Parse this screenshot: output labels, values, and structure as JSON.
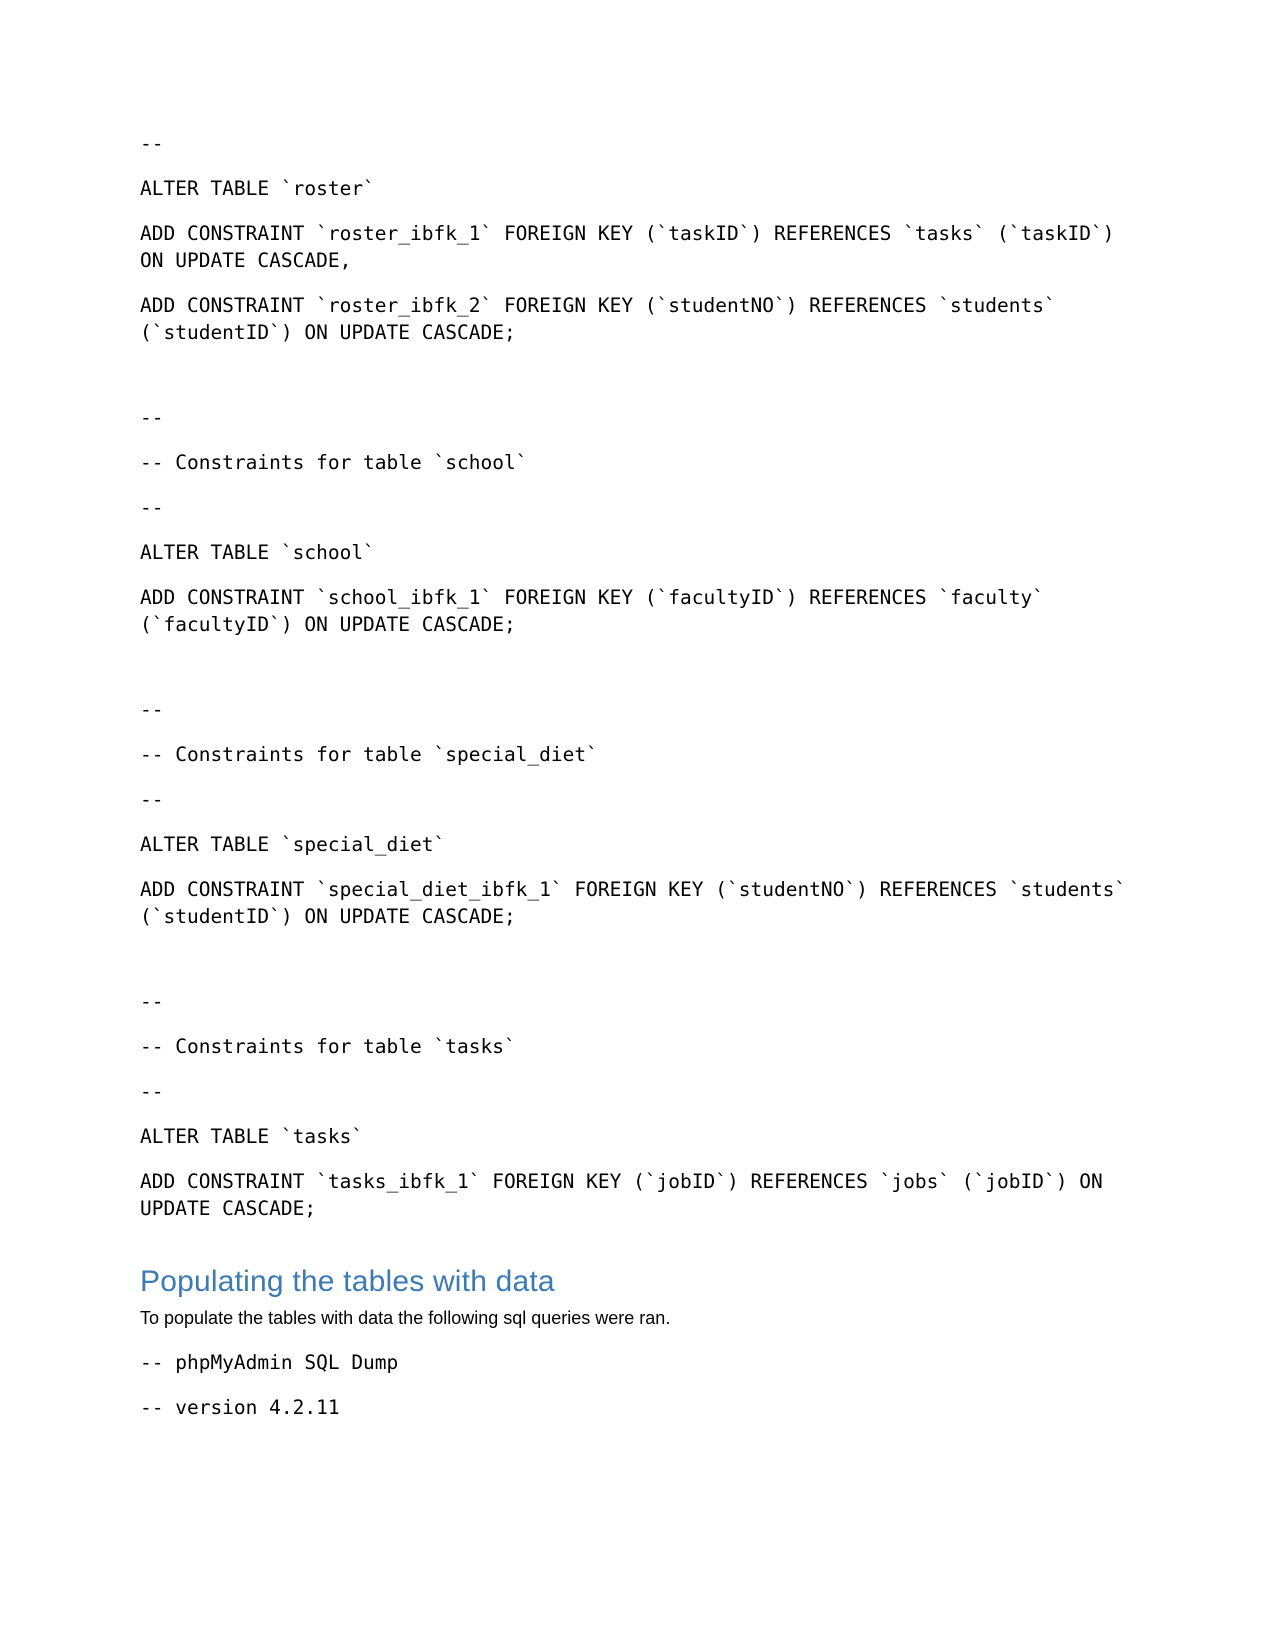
{
  "document": {
    "blocks": [
      {
        "type": "code",
        "text": "--"
      },
      {
        "type": "code",
        "text": "ALTER TABLE `roster`"
      },
      {
        "type": "code",
        "text": "ADD CONSTRAINT `roster_ibfk_1` FOREIGN KEY (`taskID`) REFERENCES `tasks` (`taskID`) ON UPDATE CASCADE,"
      },
      {
        "type": "code",
        "text": "ADD CONSTRAINT `roster_ibfk_2` FOREIGN KEY (`studentNO`) REFERENCES `students` (`studentID`) ON UPDATE CASCADE;"
      },
      {
        "type": "spacer"
      },
      {
        "type": "code",
        "text": "--"
      },
      {
        "type": "code",
        "text": "-- Constraints for table `school`"
      },
      {
        "type": "code",
        "text": "--"
      },
      {
        "type": "code",
        "text": "ALTER TABLE `school`"
      },
      {
        "type": "code",
        "text": "ADD CONSTRAINT `school_ibfk_1` FOREIGN KEY (`facultyID`) REFERENCES `faculty` (`facultyID`) ON UPDATE CASCADE;"
      },
      {
        "type": "spacer"
      },
      {
        "type": "code",
        "text": "--"
      },
      {
        "type": "code",
        "text": "-- Constraints for table `special_diet`"
      },
      {
        "type": "code",
        "text": "--"
      },
      {
        "type": "code",
        "text": "ALTER TABLE `special_diet`"
      },
      {
        "type": "code",
        "text": "ADD CONSTRAINT `special_diet_ibfk_1` FOREIGN KEY (`studentNO`) REFERENCES `students` (`studentID`) ON UPDATE CASCADE;"
      },
      {
        "type": "spacer"
      },
      {
        "type": "code",
        "text": "--"
      },
      {
        "type": "code",
        "text": "-- Constraints for table `tasks`"
      },
      {
        "type": "code",
        "text": "--"
      },
      {
        "type": "code",
        "text": "ALTER TABLE `tasks`"
      },
      {
        "type": "code",
        "text": "ADD CONSTRAINT `tasks_ibfk_1` FOREIGN KEY (`jobID`) REFERENCES `jobs` (`jobID`) ON UPDATE CASCADE;"
      },
      {
        "type": "spacer-sm"
      },
      {
        "type": "heading",
        "text": "Populating the tables with data"
      },
      {
        "type": "body",
        "text": "To populate the tables with data the following sql queries were ran."
      },
      {
        "type": "code",
        "text": "-- phpMyAdmin SQL Dump"
      },
      {
        "type": "code",
        "text": "-- version 4.2.11"
      }
    ],
    "heading_color": "#3b7ab5"
  }
}
